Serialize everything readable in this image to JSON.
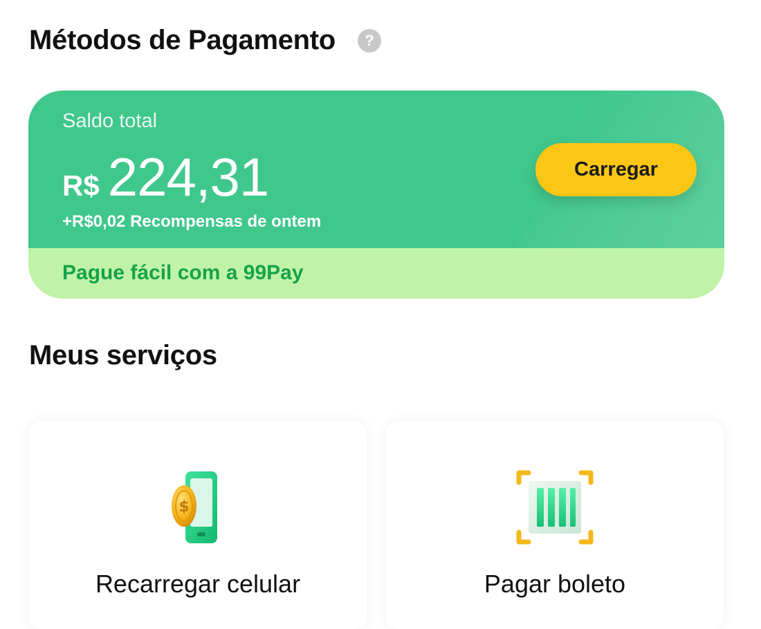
{
  "header": {
    "title": "Métodos de Pagamento",
    "help_icon": "?"
  },
  "balance": {
    "label": "Saldo total",
    "currency": "R$",
    "amount": "224,31",
    "rewards_text": "+R$0,02 Recompensas de ontem",
    "topup_label": "Carregar",
    "promo_text": "Pague fácil com a 99Pay"
  },
  "services": {
    "title": "Meus serviços",
    "items": [
      {
        "label": "Recarregar celular",
        "icon": "phone-coin-icon"
      },
      {
        "label": "Pagar boleto",
        "icon": "barcode-scan-icon"
      }
    ]
  },
  "colors": {
    "card_green": "#40c78c",
    "promo_band": "#c0f3a8",
    "promo_text": "#16a34a",
    "button_yellow": "#fcc614"
  }
}
